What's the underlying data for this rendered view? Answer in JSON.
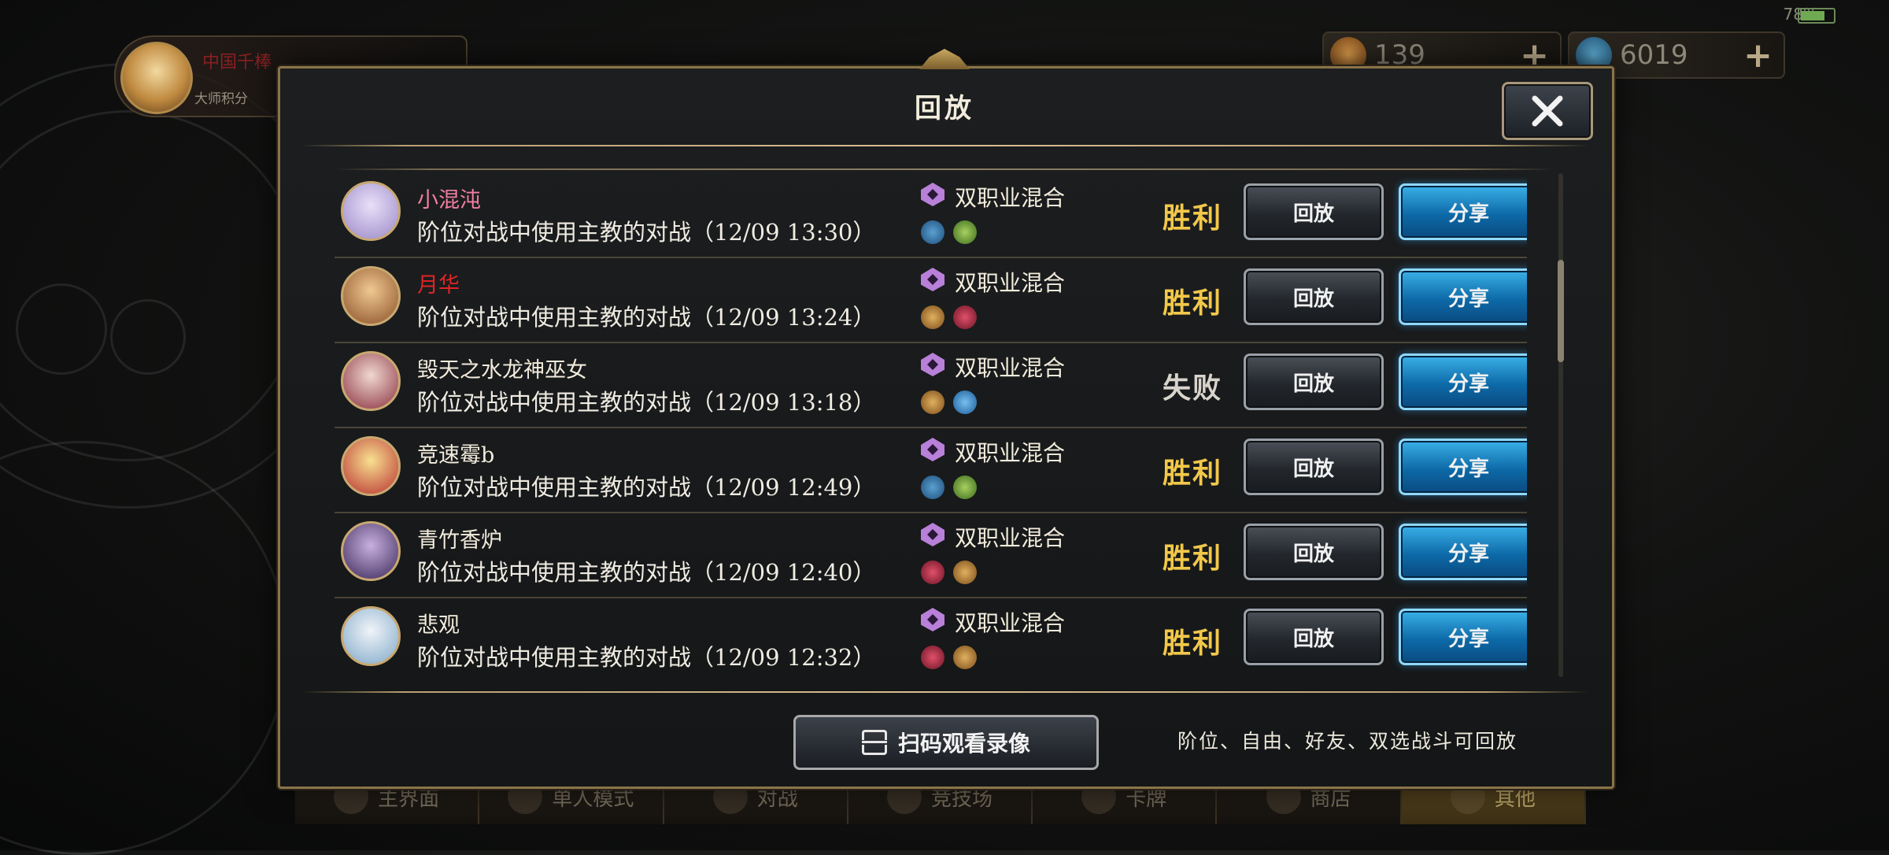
{
  "status_bar": {
    "battery": "78"
  },
  "player": {
    "name": "中国千棒",
    "rank": "大师积分"
  },
  "currencies": [
    {
      "icon": "crystal-coin-icon",
      "value": "139"
    },
    {
      "icon": "rupie-gem-icon",
      "value": "6019"
    }
  ],
  "dialog": {
    "title": "回放",
    "close_label": "✕",
    "qr_button": "扫码观看录像",
    "note": "阶位、自由、好友、双选战斗可回放"
  },
  "replays": [
    {
      "player": "小混沌",
      "name_color": "#f07fa0",
      "avatar_colors": [
        "#e8e0f8",
        "#9a88c8"
      ],
      "description": "阶位对战中使用主教的对战（12/09 13:30）",
      "mode": "双职业混合",
      "classes": [
        "cls-blue",
        "cls-green"
      ],
      "class_icons": [
        "rune-class-icon",
        "forest-class-icon"
      ],
      "result": "胜利",
      "result_type": "win",
      "replay_label": "回放",
      "share_label": "分享"
    },
    {
      "player": "月华",
      "name_color": "#e02424",
      "avatar_colors": [
        "#f0c890",
        "#8a5028"
      ],
      "description": "阶位对战中使用主教的对战（12/09 13:24）",
      "mode": "双职业混合",
      "classes": [
        "cls-brown",
        "cls-red"
      ],
      "class_icons": [
        "sword-class-icon",
        "blood-class-icon"
      ],
      "result": "胜利",
      "result_type": "win",
      "replay_label": "回放",
      "share_label": "分享"
    },
    {
      "player": "毁天之水龙神巫女",
      "name_color": "#f2ecdc",
      "avatar_colors": [
        "#f0d8d0",
        "#8a3040"
      ],
      "description": "阶位对战中使用主教的对战（12/09 13:18）",
      "mode": "双职业混合",
      "classes": [
        "cls-brown",
        "cls-sky"
      ],
      "class_icons": [
        "sword-class-icon",
        "haven-class-icon"
      ],
      "result": "失败",
      "result_type": "loss",
      "replay_label": "回放",
      "share_label": "分享"
    },
    {
      "player": "竞速霉b",
      "name_color": "#f2ecdc",
      "avatar_colors": [
        "#f8e090",
        "#b83030"
      ],
      "description": "阶位对战中使用主教的对战（12/09 12:49）",
      "mode": "双职业混合",
      "classes": [
        "cls-blue",
        "cls-green"
      ],
      "class_icons": [
        "rune-class-icon",
        "forest-class-icon"
      ],
      "result": "胜利",
      "result_type": "win",
      "replay_label": "回放",
      "share_label": "分享"
    },
    {
      "player": "青竹香炉",
      "name_color": "#f2ecdc",
      "avatar_colors": [
        "#c8b0e0",
        "#3a2858"
      ],
      "description": "阶位对战中使用主教的对战（12/09 12:40）",
      "mode": "双职业混合",
      "classes": [
        "cls-red",
        "cls-brown"
      ],
      "class_icons": [
        "blood-class-icon",
        "sword-class-icon"
      ],
      "result": "胜利",
      "result_type": "win",
      "replay_label": "回放",
      "share_label": "分享"
    },
    {
      "player": "悲观",
      "name_color": "#f2ecdc",
      "avatar_colors": [
        "#f0f4f8",
        "#80a8c8"
      ],
      "description": "阶位对战中使用主教的对战（12/09 12:32）",
      "mode": "双职业混合",
      "classes": [
        "cls-red",
        "cls-brown"
      ],
      "class_icons": [
        "blood-class-icon",
        "sword-class-icon"
      ],
      "result": "胜利",
      "result_type": "win",
      "replay_label": "回放",
      "share_label": "分享"
    }
  ],
  "bottom_nav": [
    {
      "label": "主界面",
      "icon": "home-icon"
    },
    {
      "label": "单人模式",
      "icon": "sword-icon"
    },
    {
      "label": "对战",
      "icon": "crossed-swords-icon"
    },
    {
      "label": "竞技场",
      "icon": "arena-icon"
    },
    {
      "label": "卡牌",
      "icon": "cards-icon"
    },
    {
      "label": "商店",
      "icon": "shop-icon"
    },
    {
      "label": "其他",
      "icon": "other-icon",
      "active": true
    }
  ],
  "colors": {
    "accent_gold": "#f2c84a",
    "share_blue": "#1890d8",
    "frame_gold": "#8a7448"
  }
}
